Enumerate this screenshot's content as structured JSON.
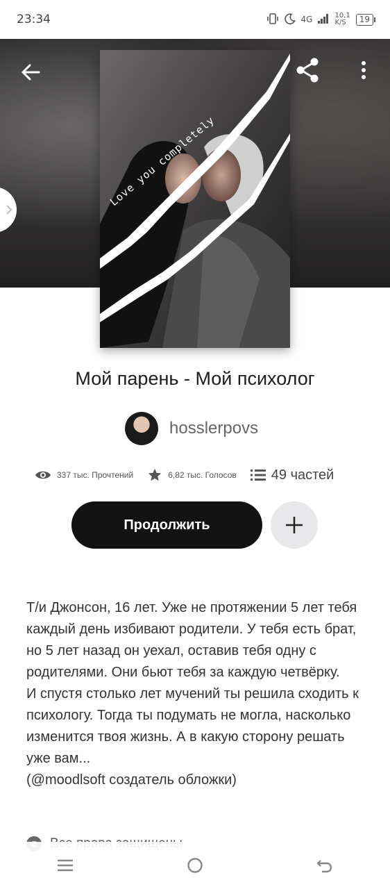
{
  "status_bar": {
    "time": "23:34",
    "network_label": "4G",
    "speed": "10,1",
    "speed_unit": "K/S",
    "battery": "19"
  },
  "icons": {
    "back": "arrow-left-icon",
    "share": "share-icon",
    "more": "more-vertical-icon",
    "views": "eye-icon",
    "votes": "star-icon",
    "parts": "list-icon",
    "add": "plus-icon"
  },
  "cover": {
    "caption": "Love you completely"
  },
  "story": {
    "title": "Мой парень - Мой психолог",
    "author": "hosslerpovs",
    "reads": "337 тыс. Прочтений",
    "votes": "6,82 тыс. Голосов",
    "parts": "49 частей",
    "continue_label": "Продолжить",
    "description_1": "Т/и Джонсон, 16 лет. Уже не протяжении 5 лет тебя каждый день избивают родители. У тебя есть брат, но 5 лет назад он уехал, оставив тебя одну с родителями. Они бьют тебя за каждую четвёрку.",
    "description_2": "И спустя столько лет мучений ты решила сходить к психологу. Тогда ты подумать не могла, насколько изменится твоя жизнь. А в какую сторону решать уже вам...",
    "description_3": "(@moodlsoft создатель обложки)",
    "rights": "Все права защищены"
  },
  "colors": {
    "primary_button": "#121212",
    "secondary_button": "#e9e9ec"
  }
}
